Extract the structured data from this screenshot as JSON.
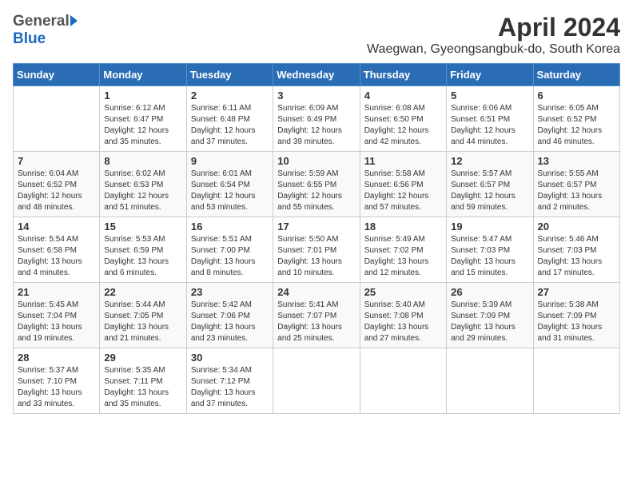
{
  "header": {
    "logo_general": "General",
    "logo_blue": "Blue",
    "title": "April 2024",
    "subtitle": "Waegwan, Gyeongsangbuk-do, South Korea"
  },
  "weekdays": [
    "Sunday",
    "Monday",
    "Tuesday",
    "Wednesday",
    "Thursday",
    "Friday",
    "Saturday"
  ],
  "weeks": [
    [
      {
        "day": "",
        "info": ""
      },
      {
        "day": "1",
        "info": "Sunrise: 6:12 AM\nSunset: 6:47 PM\nDaylight: 12 hours\nand 35 minutes."
      },
      {
        "day": "2",
        "info": "Sunrise: 6:11 AM\nSunset: 6:48 PM\nDaylight: 12 hours\nand 37 minutes."
      },
      {
        "day": "3",
        "info": "Sunrise: 6:09 AM\nSunset: 6:49 PM\nDaylight: 12 hours\nand 39 minutes."
      },
      {
        "day": "4",
        "info": "Sunrise: 6:08 AM\nSunset: 6:50 PM\nDaylight: 12 hours\nand 42 minutes."
      },
      {
        "day": "5",
        "info": "Sunrise: 6:06 AM\nSunset: 6:51 PM\nDaylight: 12 hours\nand 44 minutes."
      },
      {
        "day": "6",
        "info": "Sunrise: 6:05 AM\nSunset: 6:52 PM\nDaylight: 12 hours\nand 46 minutes."
      }
    ],
    [
      {
        "day": "7",
        "info": "Sunrise: 6:04 AM\nSunset: 6:52 PM\nDaylight: 12 hours\nand 48 minutes."
      },
      {
        "day": "8",
        "info": "Sunrise: 6:02 AM\nSunset: 6:53 PM\nDaylight: 12 hours\nand 51 minutes."
      },
      {
        "day": "9",
        "info": "Sunrise: 6:01 AM\nSunset: 6:54 PM\nDaylight: 12 hours\nand 53 minutes."
      },
      {
        "day": "10",
        "info": "Sunrise: 5:59 AM\nSunset: 6:55 PM\nDaylight: 12 hours\nand 55 minutes."
      },
      {
        "day": "11",
        "info": "Sunrise: 5:58 AM\nSunset: 6:56 PM\nDaylight: 12 hours\nand 57 minutes."
      },
      {
        "day": "12",
        "info": "Sunrise: 5:57 AM\nSunset: 6:57 PM\nDaylight: 12 hours\nand 59 minutes."
      },
      {
        "day": "13",
        "info": "Sunrise: 5:55 AM\nSunset: 6:57 PM\nDaylight: 13 hours\nand 2 minutes."
      }
    ],
    [
      {
        "day": "14",
        "info": "Sunrise: 5:54 AM\nSunset: 6:58 PM\nDaylight: 13 hours\nand 4 minutes."
      },
      {
        "day": "15",
        "info": "Sunrise: 5:53 AM\nSunset: 6:59 PM\nDaylight: 13 hours\nand 6 minutes."
      },
      {
        "day": "16",
        "info": "Sunrise: 5:51 AM\nSunset: 7:00 PM\nDaylight: 13 hours\nand 8 minutes."
      },
      {
        "day": "17",
        "info": "Sunrise: 5:50 AM\nSunset: 7:01 PM\nDaylight: 13 hours\nand 10 minutes."
      },
      {
        "day": "18",
        "info": "Sunrise: 5:49 AM\nSunset: 7:02 PM\nDaylight: 13 hours\nand 12 minutes."
      },
      {
        "day": "19",
        "info": "Sunrise: 5:47 AM\nSunset: 7:03 PM\nDaylight: 13 hours\nand 15 minutes."
      },
      {
        "day": "20",
        "info": "Sunrise: 5:46 AM\nSunset: 7:03 PM\nDaylight: 13 hours\nand 17 minutes."
      }
    ],
    [
      {
        "day": "21",
        "info": "Sunrise: 5:45 AM\nSunset: 7:04 PM\nDaylight: 13 hours\nand 19 minutes."
      },
      {
        "day": "22",
        "info": "Sunrise: 5:44 AM\nSunset: 7:05 PM\nDaylight: 13 hours\nand 21 minutes."
      },
      {
        "day": "23",
        "info": "Sunrise: 5:42 AM\nSunset: 7:06 PM\nDaylight: 13 hours\nand 23 minutes."
      },
      {
        "day": "24",
        "info": "Sunrise: 5:41 AM\nSunset: 7:07 PM\nDaylight: 13 hours\nand 25 minutes."
      },
      {
        "day": "25",
        "info": "Sunrise: 5:40 AM\nSunset: 7:08 PM\nDaylight: 13 hours\nand 27 minutes."
      },
      {
        "day": "26",
        "info": "Sunrise: 5:39 AM\nSunset: 7:09 PM\nDaylight: 13 hours\nand 29 minutes."
      },
      {
        "day": "27",
        "info": "Sunrise: 5:38 AM\nSunset: 7:09 PM\nDaylight: 13 hours\nand 31 minutes."
      }
    ],
    [
      {
        "day": "28",
        "info": "Sunrise: 5:37 AM\nSunset: 7:10 PM\nDaylight: 13 hours\nand 33 minutes."
      },
      {
        "day": "29",
        "info": "Sunrise: 5:35 AM\nSunset: 7:11 PM\nDaylight: 13 hours\nand 35 minutes."
      },
      {
        "day": "30",
        "info": "Sunrise: 5:34 AM\nSunset: 7:12 PM\nDaylight: 13 hours\nand 37 minutes."
      },
      {
        "day": "",
        "info": ""
      },
      {
        "day": "",
        "info": ""
      },
      {
        "day": "",
        "info": ""
      },
      {
        "day": "",
        "info": ""
      }
    ]
  ]
}
